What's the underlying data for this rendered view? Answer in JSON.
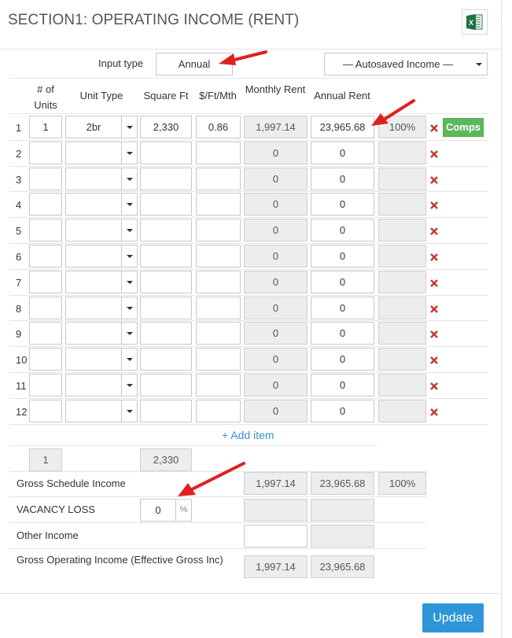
{
  "title": "SECTION1: OPERATING INCOME (RENT)",
  "icons": {
    "excel": "excel-export-icon",
    "delete": "delete-x-icon",
    "annotation": "red-arrow-annotation"
  },
  "colors": {
    "comps_button": "#5cb85c",
    "update_button": "#2e95d8",
    "delete_x": "#c0392b",
    "add_link": "#3a8fd6",
    "annotation_arrow": "#e02020"
  },
  "input_type": {
    "label": "Input type",
    "value": "Annual"
  },
  "autosaved": {
    "value": "— Autosaved Income —"
  },
  "headers": {
    "units": "# of Units",
    "unit_type": "Unit Type",
    "sqft": "Square Ft",
    "ft_mth": "$/Ft/Mth",
    "monthly": "Monthly Rent",
    "annual": "Annual Rent"
  },
  "rows": [
    {
      "num": "1",
      "units": "1",
      "type": "2br",
      "sqft": "2,330",
      "ftmth": "0.86",
      "monthly": "1,997.14",
      "annual": "23,965.68",
      "pct": "100%"
    },
    {
      "num": "2",
      "units": "",
      "type": "",
      "sqft": "",
      "ftmth": "",
      "monthly": "0",
      "annual": "0",
      "pct": ""
    },
    {
      "num": "3",
      "units": "",
      "type": "",
      "sqft": "",
      "ftmth": "",
      "monthly": "0",
      "annual": "0",
      "pct": ""
    },
    {
      "num": "4",
      "units": "",
      "type": "",
      "sqft": "",
      "ftmth": "",
      "monthly": "0",
      "annual": "0",
      "pct": ""
    },
    {
      "num": "5",
      "units": "",
      "type": "",
      "sqft": "",
      "ftmth": "",
      "monthly": "0",
      "annual": "0",
      "pct": ""
    },
    {
      "num": "6",
      "units": "",
      "type": "",
      "sqft": "",
      "ftmth": "",
      "monthly": "0",
      "annual": "0",
      "pct": ""
    },
    {
      "num": "7",
      "units": "",
      "type": "",
      "sqft": "",
      "ftmth": "",
      "monthly": "0",
      "annual": "0",
      "pct": ""
    },
    {
      "num": "8",
      "units": "",
      "type": "",
      "sqft": "",
      "ftmth": "",
      "monthly": "0",
      "annual": "0",
      "pct": ""
    },
    {
      "num": "9",
      "units": "",
      "type": "",
      "sqft": "",
      "ftmth": "",
      "monthly": "0",
      "annual": "0",
      "pct": ""
    },
    {
      "num": "10",
      "units": "",
      "type": "",
      "sqft": "",
      "ftmth": "",
      "monthly": "0",
      "annual": "0",
      "pct": ""
    },
    {
      "num": "11",
      "units": "",
      "type": "",
      "sqft": "",
      "ftmth": "",
      "monthly": "0",
      "annual": "0",
      "pct": ""
    },
    {
      "num": "12",
      "units": "",
      "type": "",
      "sqft": "",
      "ftmth": "",
      "monthly": "0",
      "annual": "0",
      "pct": ""
    }
  ],
  "comps_label": "Comps",
  "add_item_label": "+ Add item",
  "totals": {
    "units": "1",
    "sqft": "2,330"
  },
  "gross_schedule": {
    "label": "Gross Schedule Income",
    "monthly": "1,997.14",
    "annual": "23,965.68",
    "pct": "100%"
  },
  "vacancy": {
    "label": "VACANCY LOSS",
    "value": "0",
    "unit": "%"
  },
  "other_income": {
    "label": "Other Income",
    "value": ""
  },
  "gross_operating": {
    "label": "Gross Operating Income (Effective Gross Inc)",
    "monthly": "1,997.14",
    "annual": "23,965.68"
  },
  "update_label": "Update"
}
